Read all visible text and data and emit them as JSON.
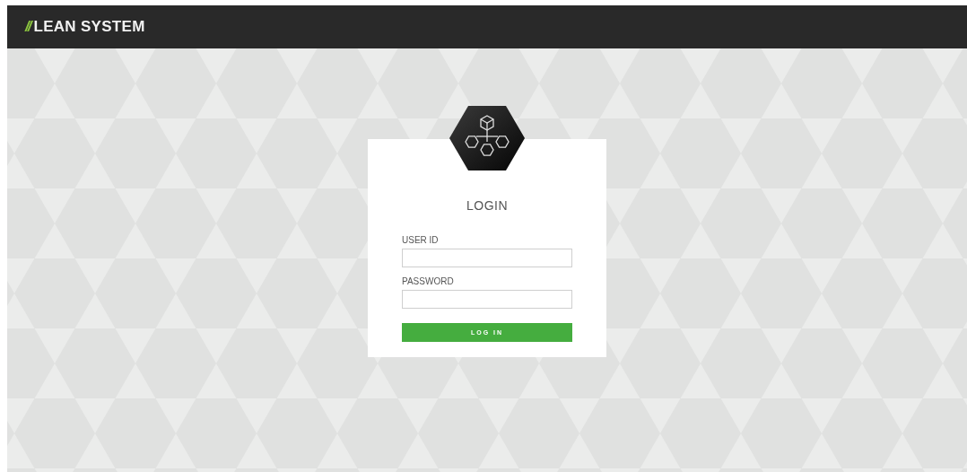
{
  "header": {
    "brand_mark": "//",
    "brand_name": "LEAN SYSTEM"
  },
  "login": {
    "title": "LOGIN",
    "fields": [
      {
        "label": "USER ID"
      },
      {
        "label": "PASSWORD"
      }
    ],
    "button": "LOG IN"
  }
}
